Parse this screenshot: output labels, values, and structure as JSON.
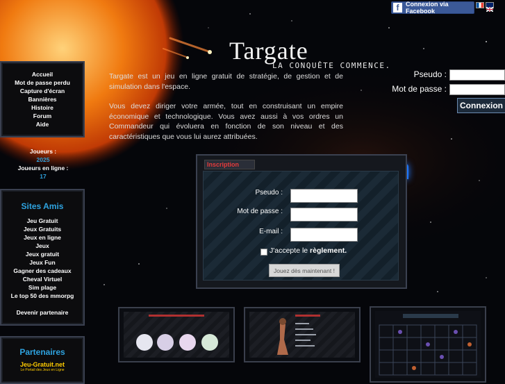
{
  "header": {
    "facebook_label": "Connexion via Facebook",
    "logo_title": "Targate",
    "logo_tagline": "La conquête commence."
  },
  "intro": {
    "p1": "Targate est un jeu en ligne gratuit de stratégie, de gestion et de simulation dans l'espace.",
    "p2": "Vous devez diriger votre armée, tout en construisant un empire économique et technologique. Vous avez aussi à vos ordres un Commandeur qui évoluera en fonction de son niveau et des caractéristiques que vous lui aurez attribuées."
  },
  "login": {
    "pseudo_label": "Pseudo :",
    "password_label": "Mot de passe :",
    "button": "Connexion"
  },
  "nav": {
    "items": [
      "Accueil",
      "Mot de passe perdu",
      "Capture d'écran",
      "Bannières",
      "Histoire",
      "Forum",
      "Aide"
    ]
  },
  "players": {
    "joueurs_label": "Joueurs :",
    "joueurs_value": "2025",
    "online_label": "Joueurs en ligne :",
    "online_value": "17"
  },
  "sites_amis": {
    "title": "Sites Amis",
    "items": [
      "Jeu Gratuit",
      "Jeux Gratuits",
      "Jeux en ligne",
      "Jeux",
      "Jeux gratuit",
      "Jeux Fun",
      "Gagner des cadeaux",
      "Cheval Virtuel",
      "Sim plage",
      "Le top 50 des mmorpg"
    ],
    "partner_link": "Devenir partenaire"
  },
  "partenaires": {
    "title": "Partenaires",
    "logo_text": "Jeu-Gratuit.net",
    "logo_sub": "Le Portail des Jeux en Ligne"
  },
  "inscription": {
    "tab": "Inscription",
    "pseudo_label": "Pseudo :",
    "password_label": "Mot de passe :",
    "email_label": "E-mail :",
    "accept_prefix": "J'accepte le",
    "accept_link": "règlement.",
    "button": "Jouez dès maintenant !"
  },
  "colors": {
    "accent_blue": "#2ea3e0",
    "tab_red": "#e53b3b",
    "facebook": "#3b5998"
  }
}
